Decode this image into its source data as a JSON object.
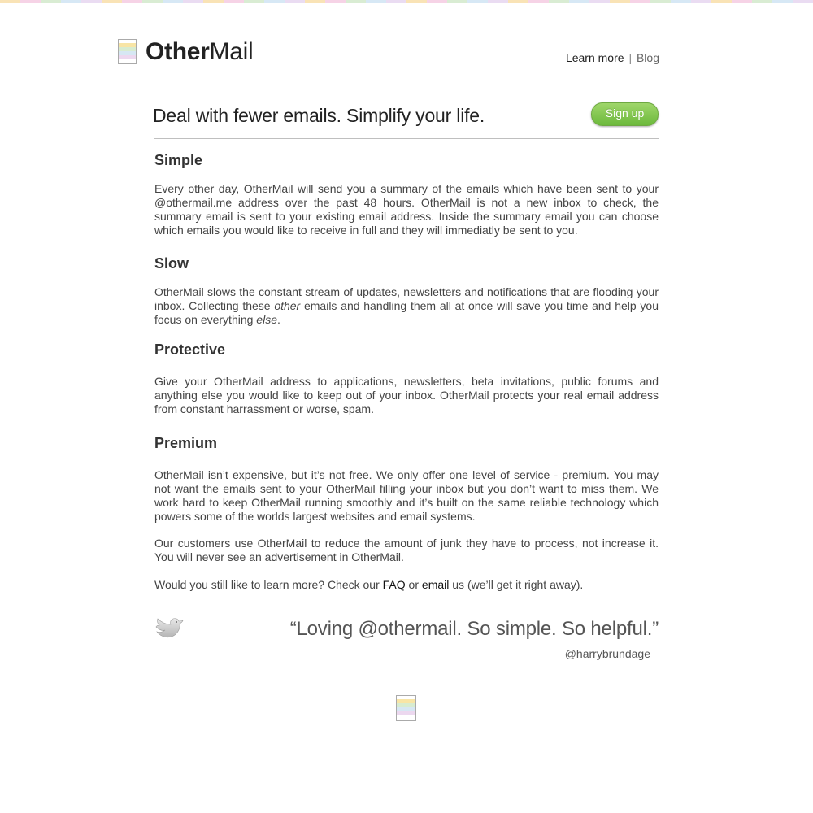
{
  "brand": {
    "name_bold": "Other",
    "name_light": "Mail",
    "icon": "notepad-logo-icon"
  },
  "nav": {
    "learn_more": "Learn more",
    "separator": "|",
    "blog": "Blog"
  },
  "hero": {
    "tagline": "Deal with fewer emails. Simplify your life.",
    "signup_label": "Sign up",
    "signup_color": "#7cc34a"
  },
  "sections": [
    {
      "title": "Simple",
      "paragraphs": [
        "Every other day, OtherMail will send you a summary of the emails which have been sent to your @othermail.me address over the past 48 hours. OtherMail is not a new inbox to check, the summary email is sent to your existing email address. Inside the summary email you can choose which emails you would like to receive in full and they will immediatly be sent to you."
      ]
    },
    {
      "title": "Slow",
      "paragraph_parts": {
        "p1": "OtherMail slows the constant stream of updates, newsletters and notifications that are flooding your inbox. Collecting these ",
        "em1": "other",
        "p2": " emails and handling them all at once will save you time and help you focus on everything ",
        "em2": "else",
        "p3": "."
      }
    },
    {
      "title": "Protective",
      "paragraphs": [
        "Give your OtherMail address to applications, newsletters, beta invitations, public forums and anything else you would like to keep out of your inbox. OtherMail protects your real email address from constant harrassment or worse, spam."
      ]
    },
    {
      "title": "Premium",
      "paragraphs": [
        "OtherMail isn’t expensive, but it’s not free. We only offer one level of service - premium. You may not want the emails sent to your OtherMail filling your inbox but you don’t want to miss them. We work hard to keep OtherMail running smoothly and it’s built on the same reliable technology which powers some of the worlds largest websites and email systems.",
        "Our customers use OtherMail to reduce the amount of junk they have to process, not increase it. You will never see an advertisement in OtherMail."
      ],
      "closing": {
        "prefix": "Would you still like to learn more? Check our ",
        "faq_link": "FAQ",
        "middle": " or ",
        "email_link": "email",
        "suffix": " us (we’ll get it right away)."
      }
    }
  ],
  "testimonial": {
    "icon": "twitter-bird-icon",
    "quote": "“Loving @othermail. So simple. So helpful.”",
    "author": "@harrybrundage"
  },
  "footer": {
    "icon": "notepad-logo-icon"
  }
}
